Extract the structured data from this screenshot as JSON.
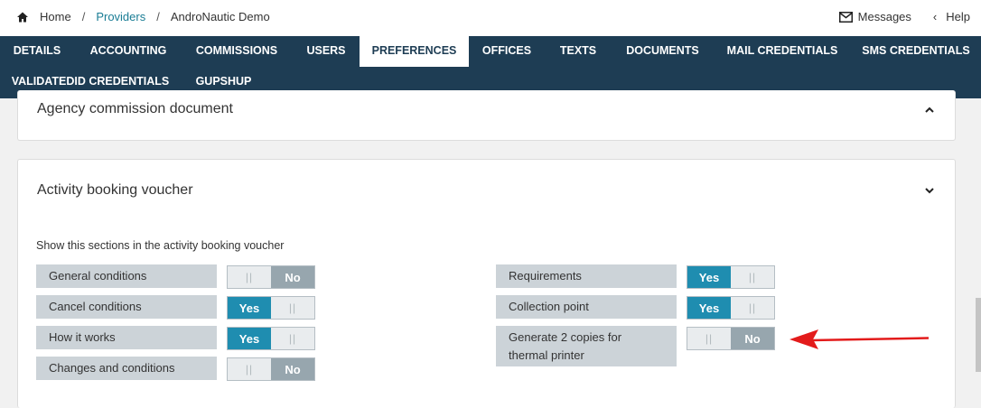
{
  "breadcrumb": {
    "home": "Home",
    "providers": "Providers",
    "current": "AndroNautic Demo",
    "sep": "/"
  },
  "top_right": {
    "messages": "Messages",
    "help": "Help"
  },
  "tabs": [
    "DETAILS",
    "ACCOUNTING",
    "COMMISSIONS",
    "USERS",
    "PREFERENCES",
    "OFFICES",
    "TEXTS",
    "DOCUMENTS",
    "MAIL CREDENTIALS",
    "SMS CREDENTIALS",
    "VALIDATEDID CREDENTIALS",
    "GUPSHUP"
  ],
  "active_tab": "PREFERENCES",
  "agency_card": {
    "title": "Agency commission document"
  },
  "voucher_card": {
    "title": "Activity booking voucher",
    "description": "Show this sections in the activity booking voucher",
    "left_options": [
      {
        "label": "General conditions",
        "value": "No"
      },
      {
        "label": "Cancel conditions",
        "value": "Yes"
      },
      {
        "label": "How it works",
        "value": "Yes"
      },
      {
        "label": "Changes and conditions",
        "value": "No"
      }
    ],
    "right_options": [
      {
        "label": "Requirements",
        "value": "Yes"
      },
      {
        "label": "Collection point",
        "value": "Yes"
      },
      {
        "label_line1": "Generate 2 copies for",
        "label_line2": "thermal printer",
        "value": "No"
      }
    ]
  },
  "toggle_labels": {
    "yes": "Yes",
    "no": "No",
    "grip": "||"
  },
  "colors": {
    "nav_bg": "#1e3d54",
    "accent": "#1f8db0",
    "link": "#1a7d95",
    "arrow": "#e31b1b"
  }
}
